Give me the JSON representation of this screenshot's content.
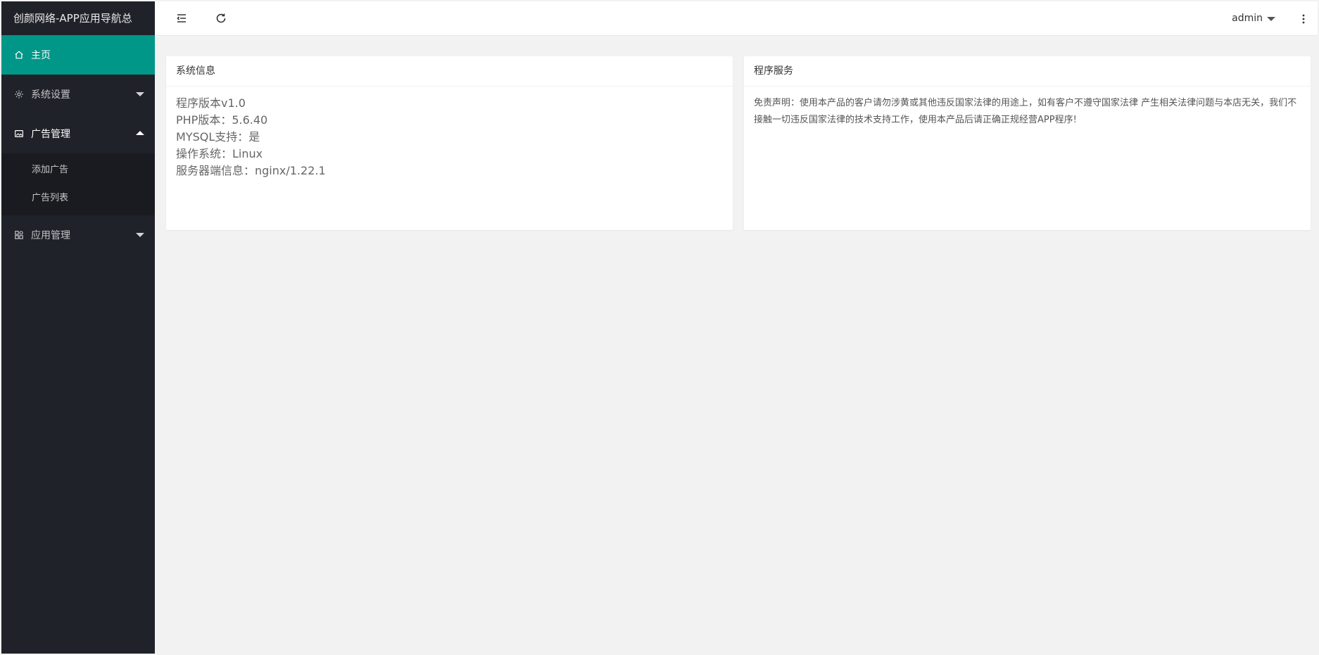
{
  "sidebar": {
    "logo": "创颜网络-APP应用导航总",
    "items": [
      {
        "label": "主页",
        "icon": "home-icon"
      },
      {
        "label": "系统设置",
        "icon": "gear-icon"
      },
      {
        "label": "广告管理",
        "icon": "image-icon"
      },
      {
        "label": "应用管理",
        "icon": "apps-icon"
      }
    ],
    "ad_sub": [
      {
        "label": "添加广告"
      },
      {
        "label": "广告列表"
      }
    ]
  },
  "header": {
    "user": "admin"
  },
  "cards": {
    "system": {
      "title": "系统信息",
      "lines": [
        "程序版本v1.0",
        "PHP版本：5.6.40",
        "MYSQL支持：是",
        "操作系统：Linux",
        "服务器端信息：nginx/1.22.1"
      ]
    },
    "service": {
      "title": "程序服务",
      "text": "免责声明：使用本产品的客户请勿涉黄或其他违反国家法律的用途上，如有客户不遵守国家法律 产生相关法律问题与本店无关，我们不接触一切违反国家法律的技术支持工作，使用本产品后请正确正规经营APP程序!"
    }
  },
  "colors": {
    "sidebar_bg": "#20222a",
    "active": "#009688",
    "page_bg": "#f2f2f2"
  }
}
